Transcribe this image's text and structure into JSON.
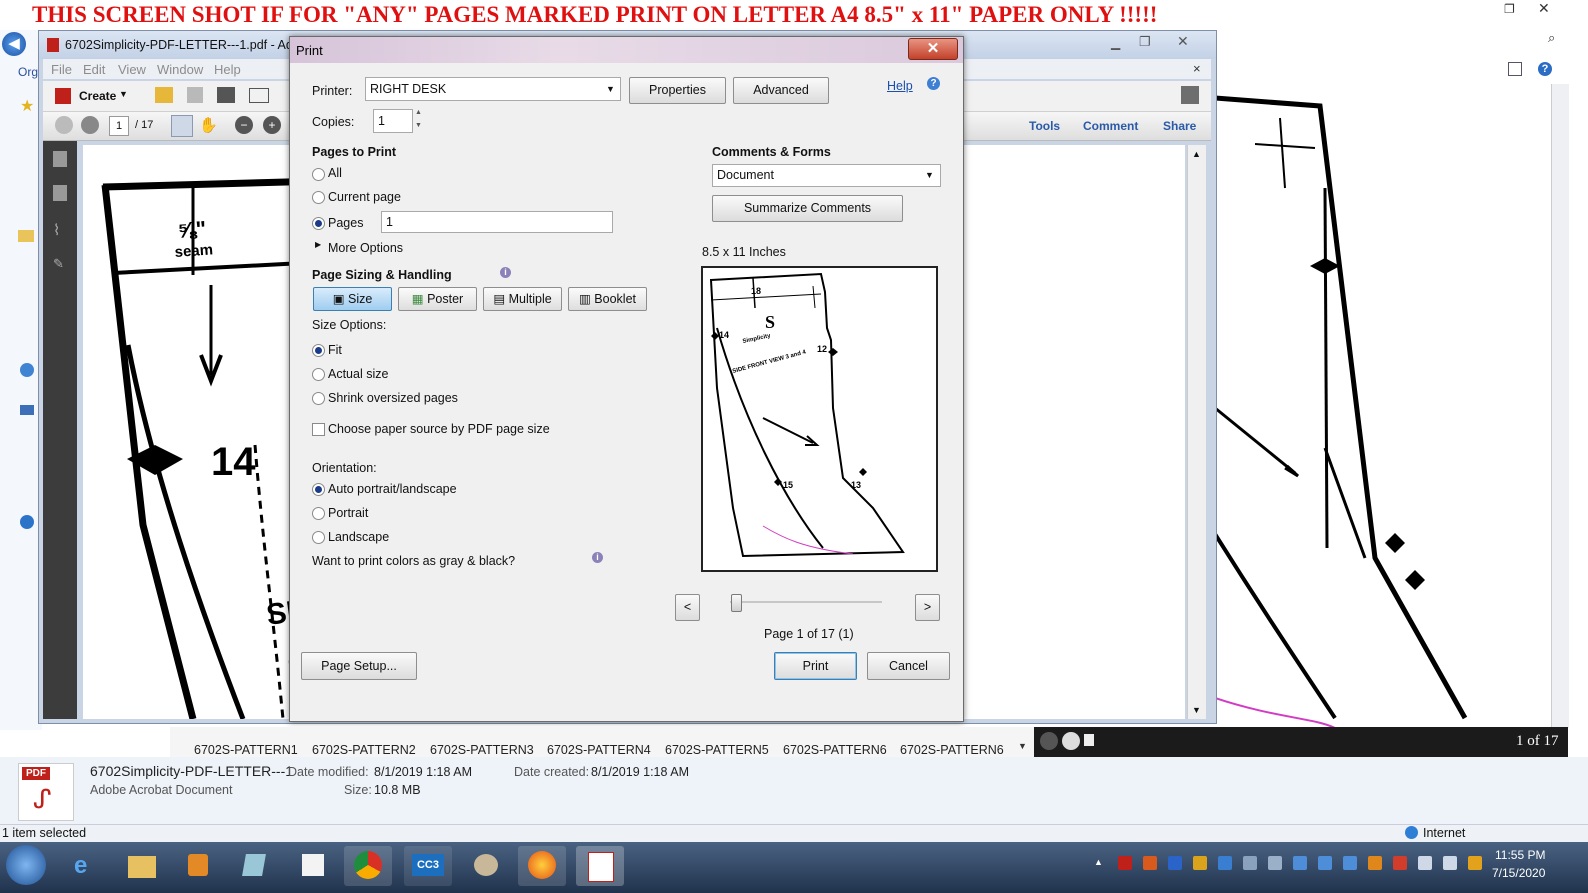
{
  "banner": "THIS SCREEN SHOT IF FOR \"ANY\" PAGES MARKED PRINT ON LETTER A4 8.5\" x  11\" PAPER ONLY !!!!!",
  "acrobat": {
    "title": "6702Simplicity-PDF-LETTER---1.pdf - Ado",
    "menu": [
      "File",
      "Edit",
      "View",
      "Window",
      "Help"
    ],
    "create_label": "Create",
    "page_current": "1",
    "page_total": "/ 17",
    "tools_tabs": [
      "Tools",
      "Comment",
      "Share"
    ]
  },
  "explorer_left_label": "Org",
  "print_dialog": {
    "title": "Print",
    "close_glyph": "✕",
    "printer_label": "Printer:",
    "printer_value": "RIGHT DESK",
    "properties_label": "Properties",
    "advanced_label": "Advanced",
    "help_label": "Help",
    "copies_label": "Copies:",
    "copies_value": "1",
    "pages_to_print": {
      "heading": "Pages to Print",
      "options": [
        "All",
        "Current page",
        "Pages"
      ],
      "selected": "Pages",
      "pages_value": "1",
      "more_options_label": "More Options"
    },
    "sizing": {
      "heading": "Page Sizing & Handling",
      "modes": [
        "Size",
        "Poster",
        "Multiple",
        "Booklet"
      ],
      "selected_mode": "Size",
      "size_options_label": "Size Options:",
      "size_options": [
        "Fit",
        "Actual size",
        "Shrink oversized pages"
      ],
      "selected_size": "Fit",
      "paper_source_label": "Choose paper source by PDF page size",
      "paper_source_checked": false
    },
    "orientation": {
      "label": "Orientation:",
      "options": [
        "Auto portrait/landscape",
        "Portrait",
        "Landscape"
      ],
      "selected": "Auto portrait/landscape"
    },
    "gray_label": "Want to print colors as gray & black?",
    "comments_forms": {
      "heading": "Comments & Forms",
      "value": "Document",
      "summarize_label": "Summarize Comments"
    },
    "preview": {
      "paper_label": "8.5 x 11 Inches",
      "page_status": "Page 1 of 17 (1)",
      "prev_label": "<",
      "next_label": ">",
      "slider_position_fraction": 0.0
    },
    "page_setup_label": "Page Setup...",
    "print_label": "Print",
    "cancel_label": "Cancel"
  },
  "thumbnails": [
    "6702S-PATTERN1",
    "6702S-PATTERN2",
    "6702S-PATTERN3",
    "6702S-PATTERN4",
    "6702S-PATTERN5",
    "6702S-PATTERN6",
    "6702S-PATTERN6"
  ],
  "viewer_page_count": "1 of 17",
  "file_details": {
    "badge": "PDF",
    "name": "6702Simplicity-PDF-LETTER---1",
    "type": "Adobe Acrobat Document",
    "modified_label": "Date modified:",
    "modified_value": "8/1/2019 1:18 AM",
    "created_label": "Date created:",
    "created_value": "8/1/2019 1:18 AM",
    "size_label": "Size:",
    "size_value": "10.8 MB"
  },
  "status": {
    "left": "1 item selected",
    "zone": "Internet"
  },
  "taskbar": {
    "time": "11:55 PM",
    "date": "7/15/2020",
    "app_label_cc3": "CC3"
  },
  "colors": {
    "banner_red": "#e01010",
    "dialog_accent": "#3c7fb1",
    "taskbar": "#2a3f5c"
  }
}
